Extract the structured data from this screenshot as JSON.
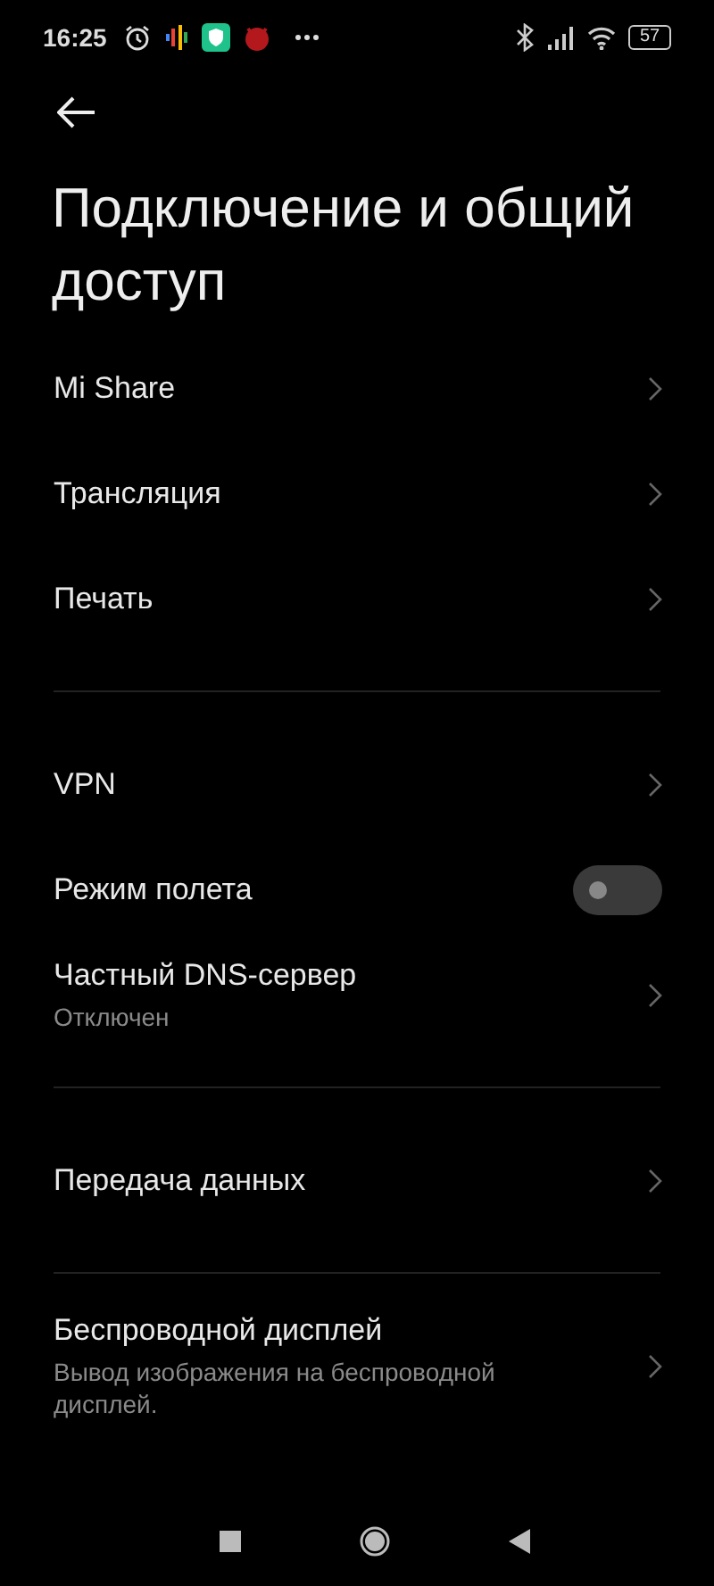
{
  "status_bar": {
    "time": "16:25",
    "battery": "57"
  },
  "title": "Подключение и общий доступ",
  "sections": [
    [
      {
        "kind": "link",
        "label": "Mi Share"
      },
      {
        "kind": "link",
        "label": "Трансляция"
      },
      {
        "kind": "link",
        "label": "Печать"
      }
    ],
    [
      {
        "kind": "link",
        "label": "VPN"
      },
      {
        "kind": "toggle",
        "label": "Режим полета",
        "on": false
      },
      {
        "kind": "link",
        "label": "Частный DNS-сервер",
        "subtitle": "Отключен"
      }
    ],
    [
      {
        "kind": "link",
        "label": "Передача данных"
      }
    ],
    [
      {
        "kind": "link",
        "label": "Беспроводной дисплей",
        "subtitle": "Вывод изображения на беспроводной дисплей."
      }
    ]
  ]
}
